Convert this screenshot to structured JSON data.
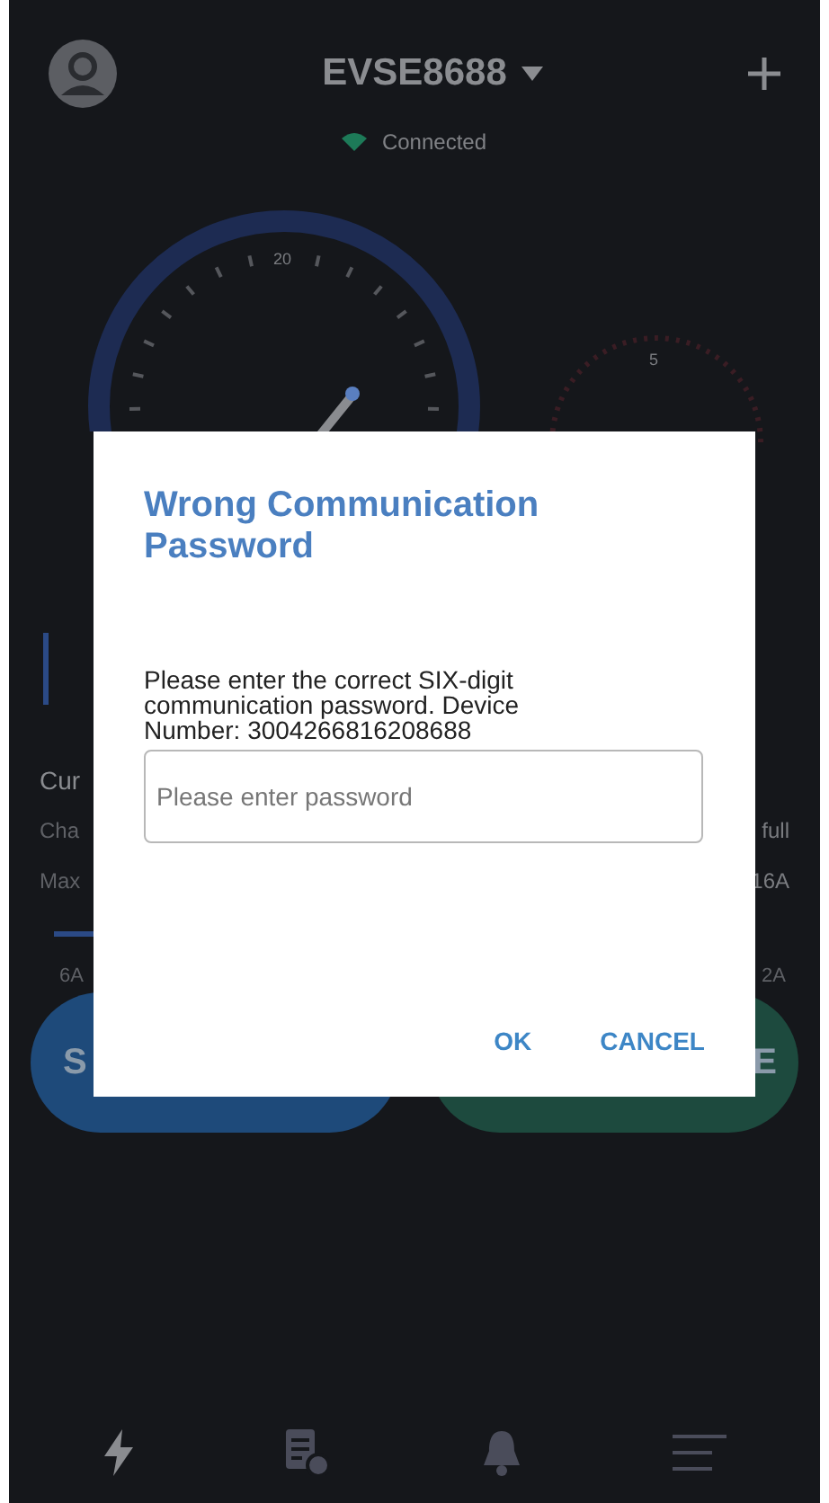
{
  "header": {
    "device": "EVSE8688",
    "status": "Connected"
  },
  "gauges": [
    {
      "label": "20"
    },
    {
      "label": "5"
    }
  ],
  "info_rows": [
    {
      "left": "Cur",
      "right": ""
    },
    {
      "left": "Cha",
      "right": "full"
    },
    {
      "left": "Max",
      "right": "16A"
    }
  ],
  "slider": {
    "min_label": "6A",
    "max_label": "2A"
  },
  "action_buttons": [
    {
      "label": "S",
      "kind": "start"
    },
    {
      "label": "E",
      "kind": "end"
    }
  ],
  "dialog": {
    "title": "Wrong Communication Password",
    "message": "Please enter the correct SIX-digit communication password. Device Number:  3004266816208688",
    "placeholder": "Please enter password",
    "buttons": [
      "OK",
      "CANCEL"
    ]
  },
  "nav": [
    {
      "kind": "charge",
      "selected": true
    },
    {
      "kind": "records",
      "selected": false
    },
    {
      "kind": "alerts",
      "selected": false
    },
    {
      "kind": "menu",
      "selected": false
    }
  ]
}
